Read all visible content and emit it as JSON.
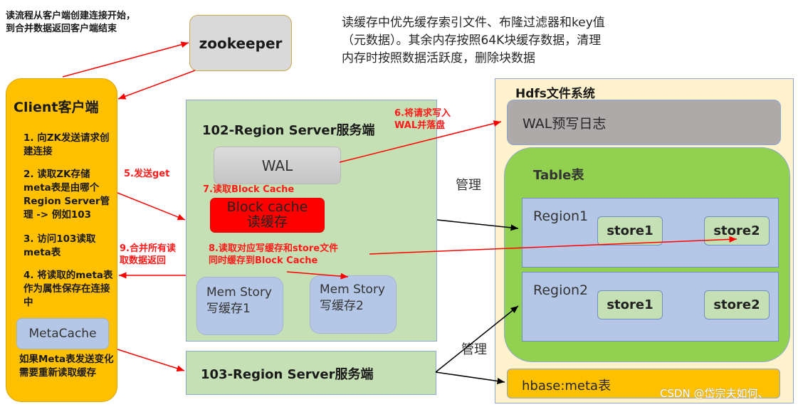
{
  "notes": {
    "flow_line1": "读流程从客户端创建连接开始，",
    "flow_line2": "到合并数据返回客户端结束",
    "cache_line1": "读缓存中优先缓存索引文件、布隆过滤器和key值",
    "cache_line2": "（元数据）。其余内存按照64K块缓存数据，清理",
    "cache_line3": "内存时按照数据活跃度，删除块数据"
  },
  "zookeeper": {
    "label": "zookeeper"
  },
  "client": {
    "title": "Client客户端",
    "steps": [
      "1. 向ZK发送请求创建连接",
      "2. 读取ZK存储meta表是由哪个Region Server管理 -> 例如103",
      "3. 访问103读取meta表",
      "4. 将读取的meta表作为属性保存在连接中"
    ],
    "metacache": "MetaCache",
    "footer": "如果Meta表发送变化需要重新读取缓存"
  },
  "rs102": {
    "title": "102-Region Server服务端",
    "wal": "WAL",
    "block_cache_line1": "Block cache",
    "block_cache_line2": "读缓存",
    "mem1_line1": "Mem Story",
    "mem1_line2": "写缓存1",
    "mem2_line1": "Mem Story",
    "mem2_line2": "写缓存2"
  },
  "rs103": {
    "title": "103-Region Server服务端"
  },
  "hdfs": {
    "title": "Hdfs文件系统",
    "wal_log": "WAL预写日志",
    "table": "Table表",
    "regions": [
      {
        "name": "Region1",
        "stores": [
          "store1",
          "store2"
        ]
      },
      {
        "name": "Region2",
        "stores": [
          "store1",
          "store2"
        ]
      }
    ],
    "meta": "hbase:meta表"
  },
  "step_labels": {
    "s5": "5.发送get",
    "s6_line1": "6.将请求写入",
    "s6_line2": "WAL并落盘",
    "s7": "7.读取Block Cache",
    "s8_line1": "8.读取对应写缓存和store文件",
    "s8_line2": "同时缓存到Block Cache",
    "s9_line1": "9.合并所有读",
    "s9_line2": "取数据返回"
  },
  "manage_label": "管理",
  "watermark": "CSDN @岱宗夫如何、",
  "colors": {
    "client": "#ffc000",
    "region_server": "#c5e0b4",
    "hdfs": "#fff2cc",
    "table": "#92d050",
    "region": "#b4c7e7",
    "block_cache": "#ff0000",
    "arrow_red": "#ff0000",
    "arrow_black": "#000000"
  }
}
